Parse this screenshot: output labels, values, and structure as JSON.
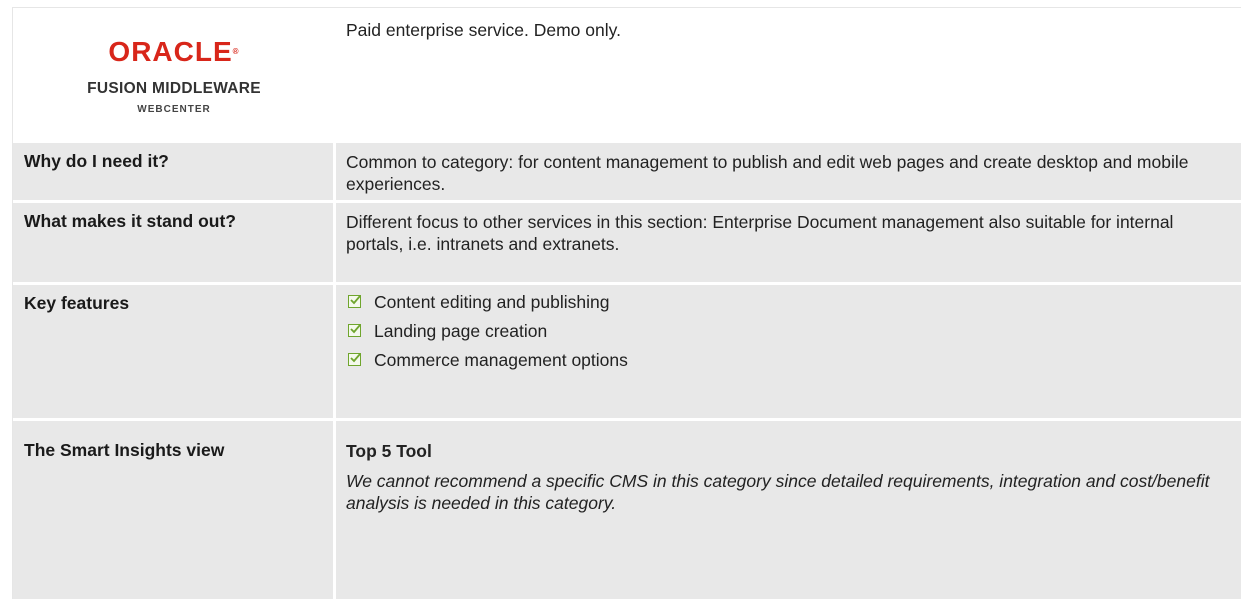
{
  "logo": {
    "brand": "ORACLE",
    "trademark": "®",
    "product_line": "FUSION MIDDLEWARE",
    "product": "WEBCENTER",
    "brand_color": "#d8261a"
  },
  "summary": "Paid enterprise service. Demo only.",
  "rows": {
    "why": {
      "label": "Why do I need it?",
      "value": "Common to category: for content management to publish and edit web pages and create desktop and mobile experiences."
    },
    "standout": {
      "label": "What makes it stand out?",
      "value": "Different focus to other services in this section: Enterprise Document management also suitable for internal portals, i.e. intranets and extranets."
    },
    "features": {
      "label": "Key features",
      "items": [
        "Content editing and publishing",
        "Landing page creation",
        "Commerce management options"
      ],
      "check_icon": "checkbox-checked-icon",
      "check_color": "#6fa52d"
    },
    "view": {
      "label": "The Smart Insights view",
      "rating": "Top 5 Tool",
      "verdict": "We cannot recommend a specific CMS in this category since detailed requirements, integration and cost/benefit analysis is needed in this category."
    }
  },
  "colors": {
    "row_background": "#e8e8e8"
  }
}
